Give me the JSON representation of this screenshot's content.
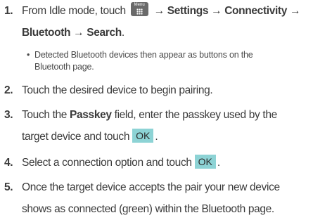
{
  "steps": [
    {
      "number": "1.",
      "line1_before": "From Idle mode, touch",
      "line1_after": "→ Settings → Connectivity →",
      "line2": "Bluetooth → Search",
      "line2_tail": ".",
      "menu_icon_label": "Menu",
      "bullet": {
        "line1": "Detected Bluetooth devices then appear as buttons on the",
        "line2": "Bluetooth page."
      }
    },
    {
      "number": "2.",
      "text": "Touch the desired device to begin pairing."
    },
    {
      "number": "3.",
      "line1_before": "Touch the ",
      "line1_bold": "Passkey",
      "line1_after": " field, enter the passkey used by the",
      "line2_before": "target device and touch",
      "button": "OK",
      "line2_after": "."
    },
    {
      "number": "4.",
      "before": "Select a connection option and touch",
      "button": "OK",
      "after": "."
    },
    {
      "number": "5.",
      "line1": "Once the target device accepts the pair your new device",
      "line2": "shows as connected (green) within the Bluetooth page."
    }
  ],
  "colors": {
    "ok_button": "#8dd3d5",
    "menu_icon": "#6a6a6a",
    "text": "#3a3a3a"
  },
  "icons": {
    "menu": "menu-grid-icon"
  }
}
